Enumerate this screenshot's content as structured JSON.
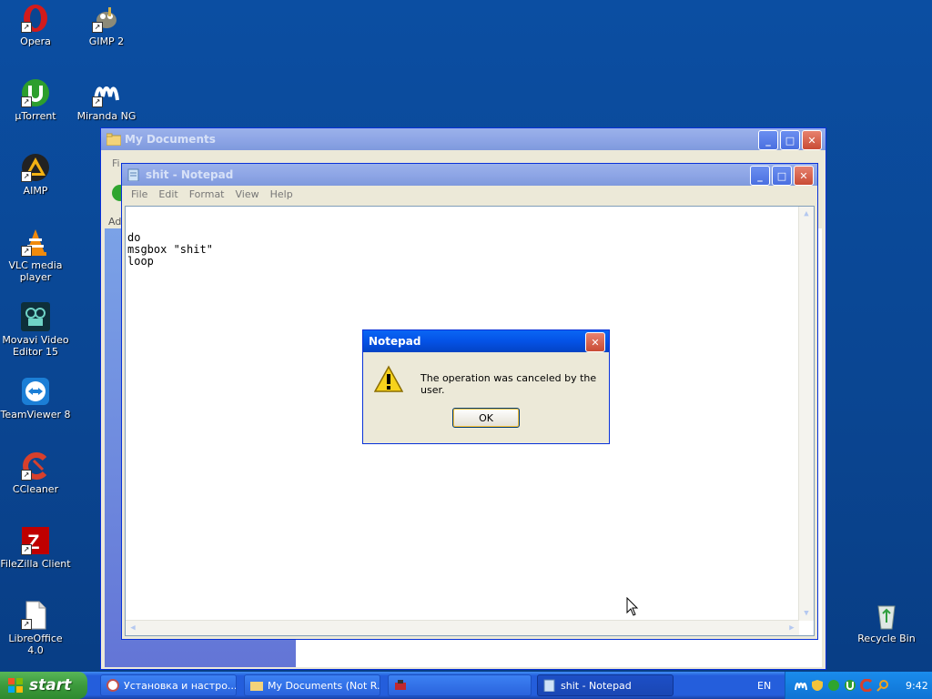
{
  "desktop": {
    "icons": [
      {
        "label": "Opera"
      },
      {
        "label": "GIMP 2"
      },
      {
        "label": "µTorrent"
      },
      {
        "label": "Miranda NG"
      },
      {
        "label": "AIMP"
      },
      {
        "label": "VLC media player"
      },
      {
        "label": "Movavi Video Editor 15"
      },
      {
        "label": "TeamViewer 8"
      },
      {
        "label": "CCleaner"
      },
      {
        "label": "FileZilla Client"
      },
      {
        "label": "LibreOffice 4.0"
      },
      {
        "label": "Recycle Bin"
      }
    ]
  },
  "explorer_window": {
    "title": "My Documents",
    "menu_fragment": "Fi",
    "address_fragment": "Ad"
  },
  "notepad": {
    "title": "shit - Notepad",
    "menu": [
      "File",
      "Edit",
      "Format",
      "View",
      "Help"
    ],
    "content": "do\nmsgbox \"shit\"\nloop"
  },
  "dialog": {
    "title": "Notepad",
    "message": "The operation was canceled by the user.",
    "ok_label": "OK"
  },
  "taskbar": {
    "start_label": "start",
    "tasks": [
      {
        "label": "Установка и настро..."
      },
      {
        "label": "My Documents (Not R..."
      },
      {
        "label": ""
      },
      {
        "label": "shit - Notepad"
      }
    ],
    "language": "EN",
    "clock": "9:42"
  },
  "colors": {
    "desktop_bg": "#0a4591",
    "titlebar_active": "#0452e6",
    "titlebar_inactive": "#7f99dd",
    "taskbar": "#245edc",
    "start_green": "#3c9a3c"
  }
}
